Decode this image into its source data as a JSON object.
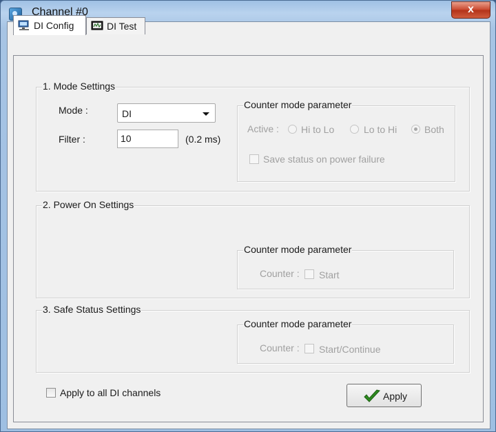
{
  "window": {
    "title": "Channel #0",
    "close_glyph": "x"
  },
  "tabs": [
    {
      "label": "DI Config",
      "icon": "network-config-icon",
      "active": true
    },
    {
      "label": "DI Test",
      "icon": "monitor-icon",
      "active": false
    }
  ],
  "mode_settings": {
    "legend": "1. Mode Settings",
    "mode_label": "Mode :",
    "mode_value": "DI",
    "filter_label": "Filter :",
    "filter_value": "10",
    "filter_unit": "(0.2 ms)",
    "counter": {
      "legend": "Counter mode parameter",
      "active_label": "Active :",
      "options": [
        "Hi to Lo",
        "Lo to Hi",
        "Both"
      ],
      "selected": "Both",
      "save_status_label": "Save status on power failure"
    }
  },
  "power_on_settings": {
    "legend": "2. Power On Settings",
    "counter": {
      "legend": "Counter mode parameter",
      "counter_label": "Counter :",
      "start_label": "Start"
    }
  },
  "safe_status_settings": {
    "legend": "3. Safe Status Settings",
    "counter": {
      "legend": "Counter mode parameter",
      "counter_label": "Counter :",
      "start_label": "Start/Continue"
    }
  },
  "footer": {
    "apply_all_label": "Apply to all DI channels",
    "apply_button_label": "Apply"
  },
  "colors": {
    "accent_check": "#2e8b1f",
    "close_button": "#c9462d",
    "disabled_text": "#a0a0a0"
  }
}
